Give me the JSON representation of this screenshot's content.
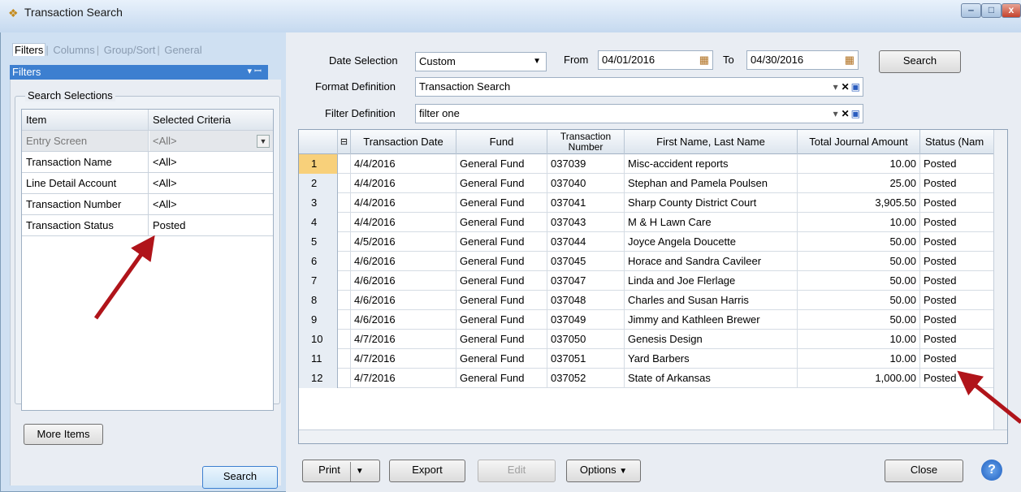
{
  "window": {
    "title": "Transaction Search",
    "min": "‒",
    "max": "□",
    "close": "x"
  },
  "left": {
    "tabs": [
      "Filters",
      "Columns",
      "Group/Sort",
      "General"
    ],
    "panel_title": "Filters",
    "panel_pin": "▾ ꟷ",
    "group_label": "Search Selections",
    "grid_headers": [
      "Item",
      "Selected Criteria"
    ],
    "rows": [
      {
        "item": "Entry Screen",
        "criteria": "<All>"
      },
      {
        "item": "Transaction Name",
        "criteria": "<All>"
      },
      {
        "item": "Line Detail Account",
        "criteria": "<All>"
      },
      {
        "item": "Transaction Number",
        "criteria": "<All>"
      },
      {
        "item": "Transaction Status",
        "criteria": "Posted"
      }
    ],
    "more_items": "More Items",
    "search": "Search"
  },
  "top": {
    "date_selection_label": "Date Selection",
    "date_selection_value": "Custom",
    "from_label": "From",
    "from_value": "04/01/2016",
    "to_label": "To",
    "to_value": "04/30/2016",
    "search": "Search",
    "format_label": "Format Definition",
    "format_value": "Transaction Search",
    "filter_label": "Filter Definition",
    "filter_value": "filter one"
  },
  "grid": {
    "headers": [
      "Transaction Date",
      "Fund",
      "Transaction Number",
      "First Name, Last Name",
      "Total Journal Amount",
      "Status (Name)"
    ],
    "header_labels": {
      "date": "Transaction Date",
      "fund": "Fund",
      "number": "Transaction Number",
      "name": "First Name, Last Name",
      "amount": "Total Journal Amount",
      "status": "Status (Nam"
    },
    "rows": [
      [
        "1",
        "4/4/2016",
        "General Fund",
        "037039",
        "Misc-accident reports",
        "10.00",
        "Posted"
      ],
      [
        "2",
        "4/4/2016",
        "General Fund",
        "037040",
        "Stephan and Pamela Poulsen",
        "25.00",
        "Posted"
      ],
      [
        "3",
        "4/4/2016",
        "General Fund",
        "037041",
        "Sharp County District Court",
        "3,905.50",
        "Posted"
      ],
      [
        "4",
        "4/4/2016",
        "General Fund",
        "037043",
        "M & H Lawn Care",
        "10.00",
        "Posted"
      ],
      [
        "5",
        "4/5/2016",
        "General Fund",
        "037044",
        "Joyce Angela Doucette",
        "50.00",
        "Posted"
      ],
      [
        "6",
        "4/6/2016",
        "General Fund",
        "037045",
        "Horace and Sandra Cavileer",
        "50.00",
        "Posted"
      ],
      [
        "7",
        "4/6/2016",
        "General Fund",
        "037047",
        "Linda and Joe Flerlage",
        "50.00",
        "Posted"
      ],
      [
        "8",
        "4/6/2016",
        "General Fund",
        "037048",
        "Charles and Susan Harris",
        "50.00",
        "Posted"
      ],
      [
        "9",
        "4/6/2016",
        "General Fund",
        "037049",
        "Jimmy and Kathleen Brewer",
        "50.00",
        "Posted"
      ],
      [
        "10",
        "4/7/2016",
        "General Fund",
        "037050",
        "Genesis Design",
        "10.00",
        "Posted"
      ],
      [
        "11",
        "4/7/2016",
        "General Fund",
        "037051",
        "Yard Barbers",
        "10.00",
        "Posted"
      ],
      [
        "12",
        "4/7/2016",
        "General Fund",
        "037052",
        "State of Arkansas",
        "1,000.00",
        "Posted"
      ]
    ]
  },
  "bottom": {
    "print": "Print",
    "export": "Export",
    "edit": "Edit",
    "options": "Options",
    "close": "Close",
    "help": "?"
  }
}
